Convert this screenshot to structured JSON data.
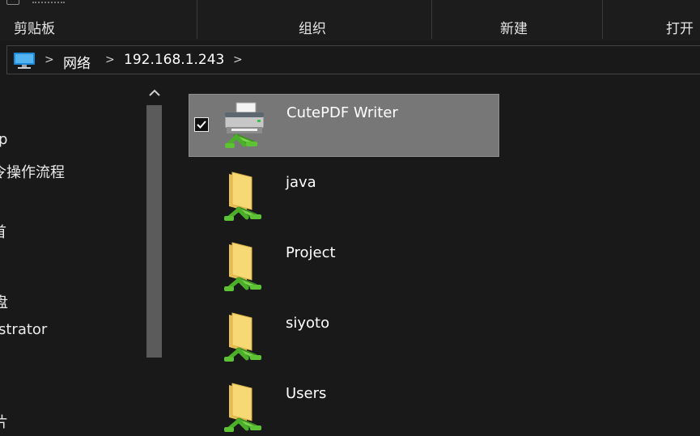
{
  "ribbon": {
    "groups": [
      {
        "label": "剪贴板"
      },
      {
        "label": "组织"
      },
      {
        "label": "新建"
      },
      {
        "label": "打开"
      }
    ]
  },
  "address_bar": {
    "icon": "computer-icon",
    "crumbs": [
      "网络",
      "192.168.1.243"
    ],
    "separator": ">"
  },
  "nav_pane": {
    "items": [
      {
        "label": "p"
      },
      {
        "label": "令操作流程"
      },
      {
        "label": "首"
      },
      {
        "label": "盘"
      },
      {
        "label": "strator"
      },
      {
        "label": "片"
      }
    ]
  },
  "content": {
    "items": [
      {
        "label": "CutePDF Writer",
        "icon": "network-printer-icon",
        "selected": true
      },
      {
        "label": "java",
        "icon": "shared-folder-icon",
        "selected": false
      },
      {
        "label": "Project",
        "icon": "shared-folder-icon",
        "selected": false
      },
      {
        "label": "siyoto",
        "icon": "shared-folder-icon",
        "selected": false
      },
      {
        "label": "Users",
        "icon": "shared-folder-icon",
        "selected": false
      }
    ]
  },
  "colors": {
    "background": "#191919",
    "selection": "#777777",
    "scroll_thumb": "#5b5b5b",
    "folder": "#f3d26f",
    "network_pipe": "#4caf2a"
  }
}
